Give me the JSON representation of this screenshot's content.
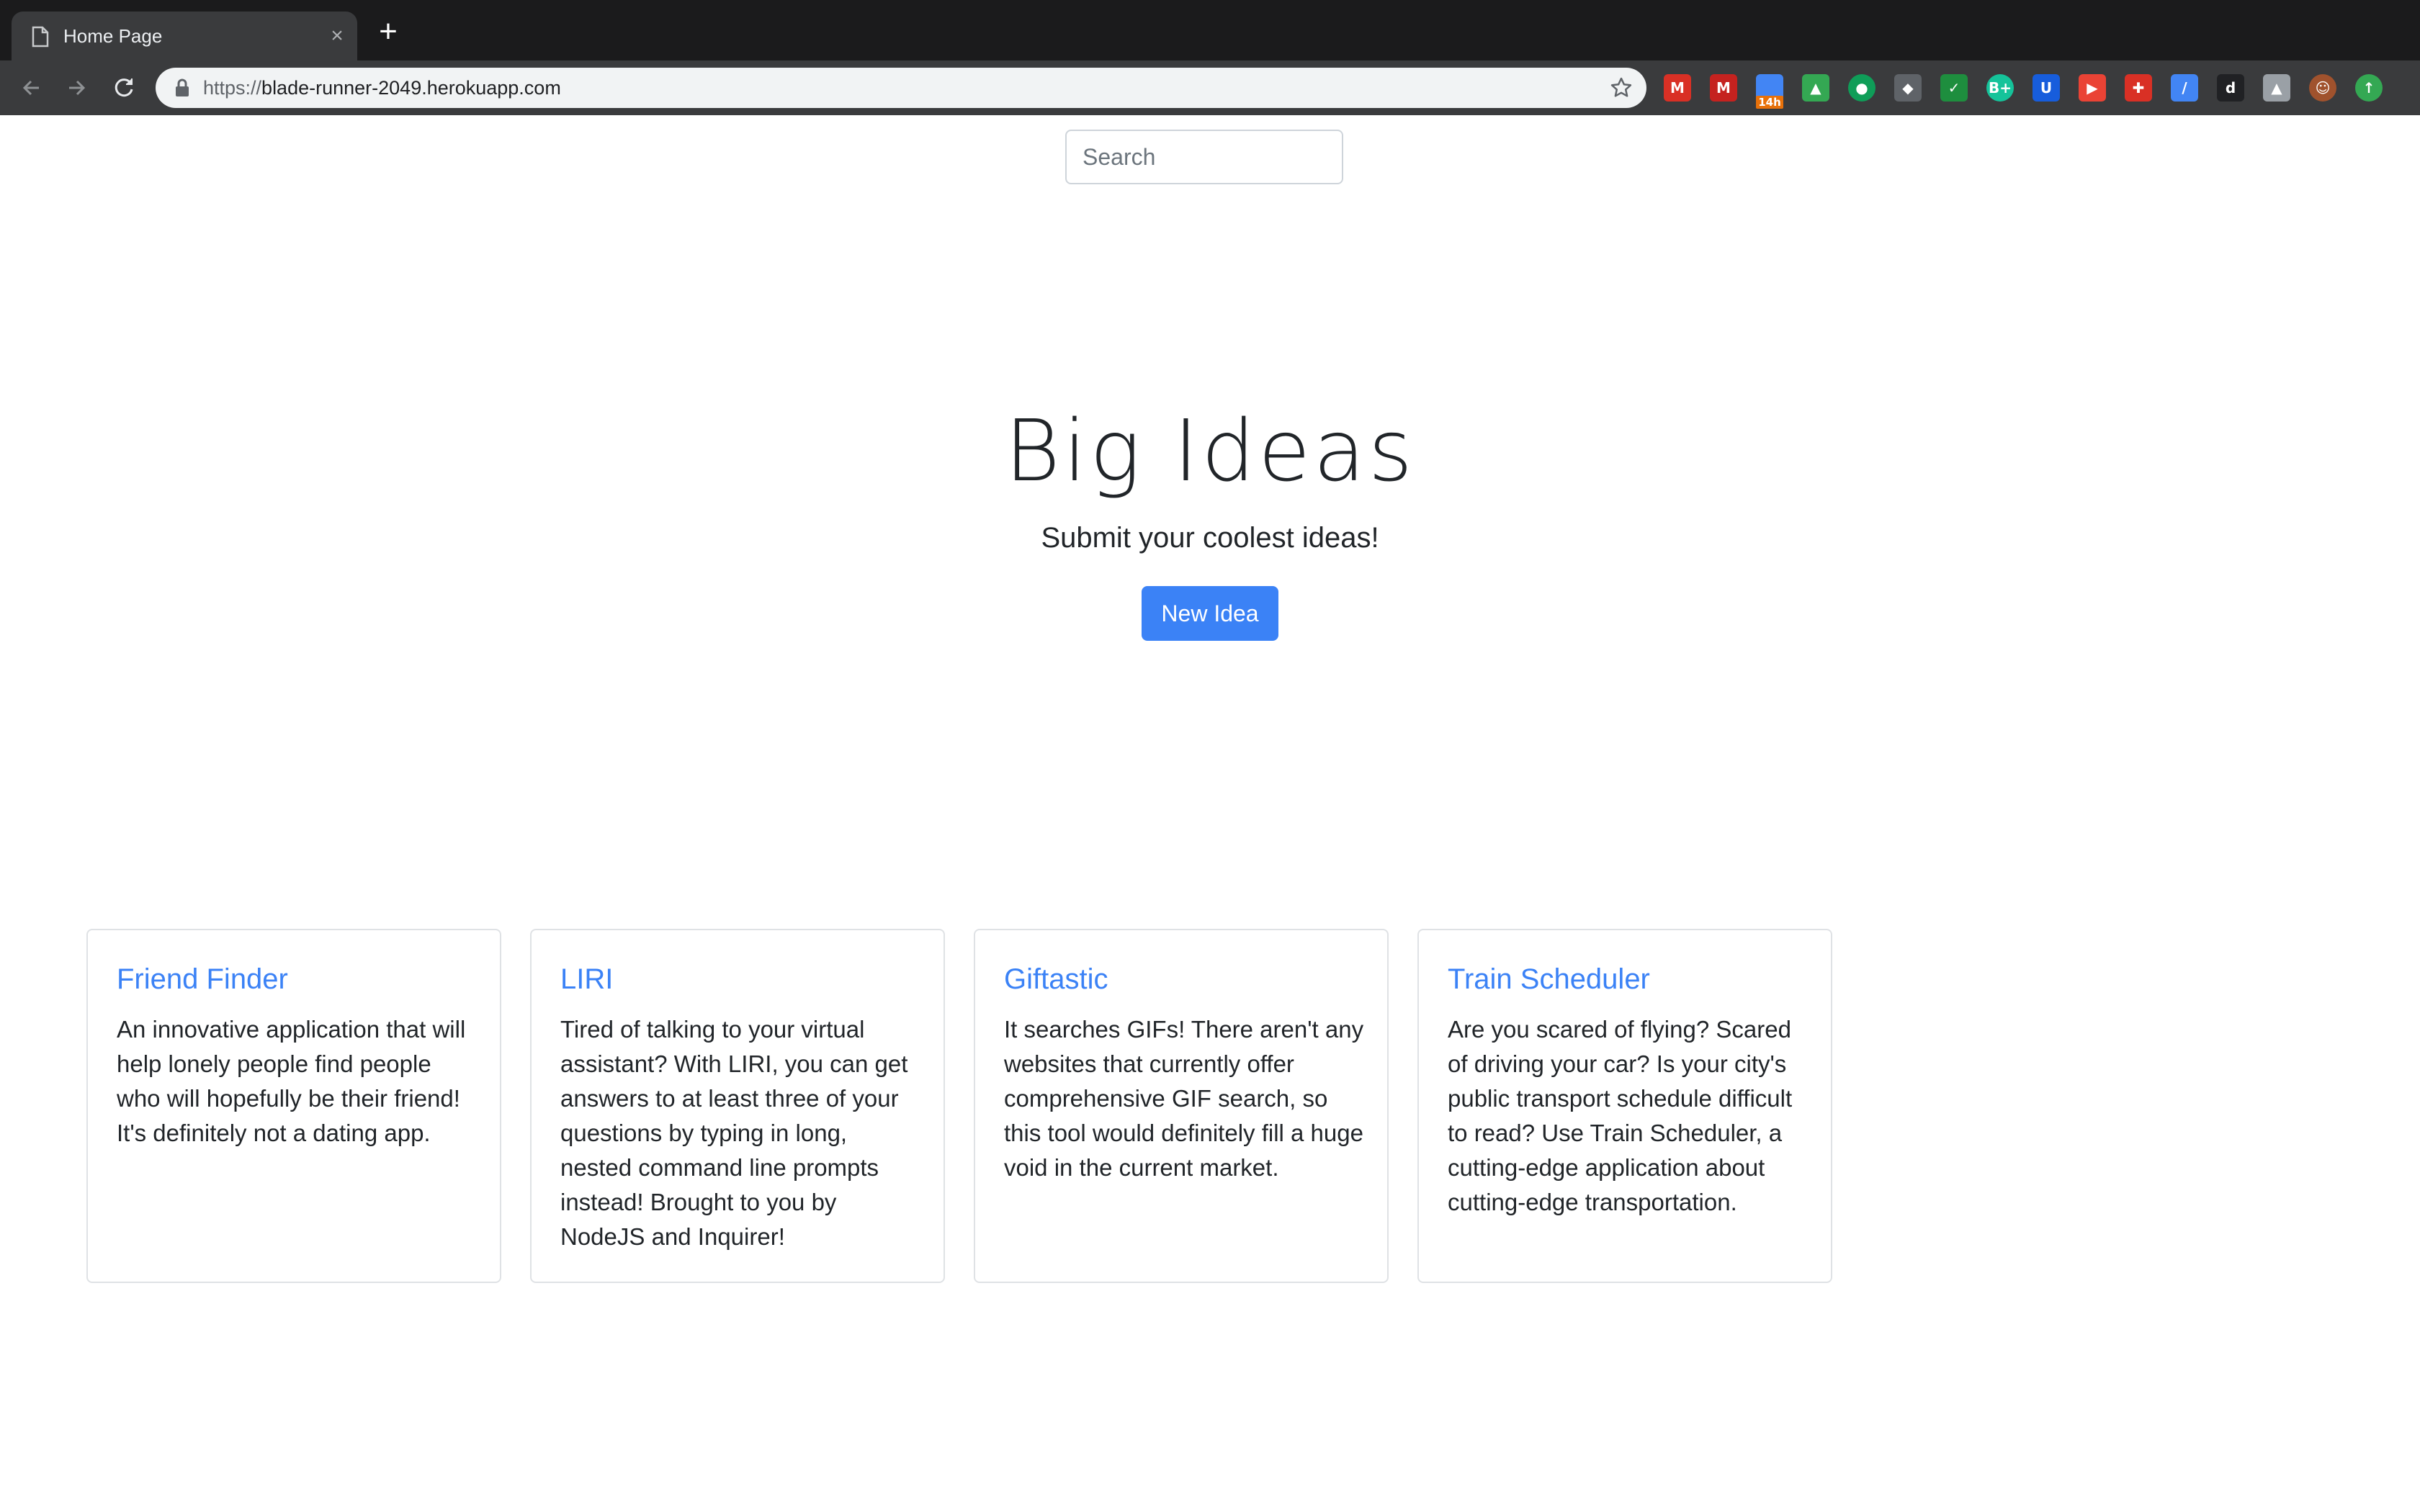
{
  "browser": {
    "tab_title": "Home Page",
    "tab_close": "×",
    "new_tab": "+",
    "url_scheme": "https://",
    "url_host": "blade-runner-2049.herokuapp.com",
    "extensions": [
      {
        "name": "gmail-icon",
        "color": "#d93025",
        "glyph": "M"
      },
      {
        "name": "gmail-icon",
        "color": "#c5221f",
        "glyph": "M"
      },
      {
        "name": "calendar-icon",
        "color": "#4285f4",
        "glyph": "",
        "badge": "14h"
      },
      {
        "name": "drive-icon",
        "color": "#34a853",
        "glyph": "▲"
      },
      {
        "name": "hangouts-icon",
        "color": "#0f9d58",
        "glyph": "●"
      },
      {
        "name": "keep-icon",
        "color": "#5f6368",
        "glyph": "◆"
      },
      {
        "name": "checkmark-icon",
        "color": "#1e8e3e",
        "glyph": "✓"
      },
      {
        "name": "grammar-icon",
        "color": "#15c39a",
        "glyph": "B+"
      },
      {
        "name": "bitwarden-icon",
        "color": "#175ddc",
        "glyph": "U"
      },
      {
        "name": "screencast-icon",
        "color": "#ea4335",
        "glyph": "▶"
      },
      {
        "name": "cross-icon",
        "color": "#d93025",
        "glyph": "✚"
      },
      {
        "name": "pen-icon",
        "color": "#4285f4",
        "glyph": "/"
      },
      {
        "name": "dark-mode-icon",
        "color": "#202124",
        "glyph": "d"
      },
      {
        "name": "drive-upload-icon",
        "color": "#9aa0a6",
        "glyph": "▲"
      },
      {
        "name": "profile-avatar-icon",
        "color": "#a0522d",
        "glyph": "☺"
      },
      {
        "name": "update-icon",
        "color": "#34a853",
        "glyph": "↑"
      }
    ]
  },
  "page": {
    "search_placeholder": "Search",
    "hero_title": "Big Ideas",
    "hero_subtitle": "Submit your coolest ideas!",
    "new_idea_label": "New Idea",
    "accent_color": "#3b82f6",
    "cards": [
      {
        "title": "Friend Finder",
        "text": "An innovative application that will help lonely people find people who will hopefully be their friend! It's definitely not a dating app."
      },
      {
        "title": "LIRI",
        "text": "Tired of talking to your virtual assistant? With LIRI, you can get answers to at least three of your questions by typing in long, nested command line prompts instead! Brought to you by NodeJS and Inquirer!"
      },
      {
        "title": "Giftastic",
        "text": "It searches GIFs! There aren't any websites that currently offer comprehensive GIF search, so this tool would definitely fill a huge void in the current market."
      },
      {
        "title": "Train Scheduler",
        "text": "Are you scared of flying? Scared of driving your car? Is your city's public transport schedule difficult to read? Use Train Scheduler, a cutting-edge application about cutting-edge transportation."
      }
    ]
  }
}
